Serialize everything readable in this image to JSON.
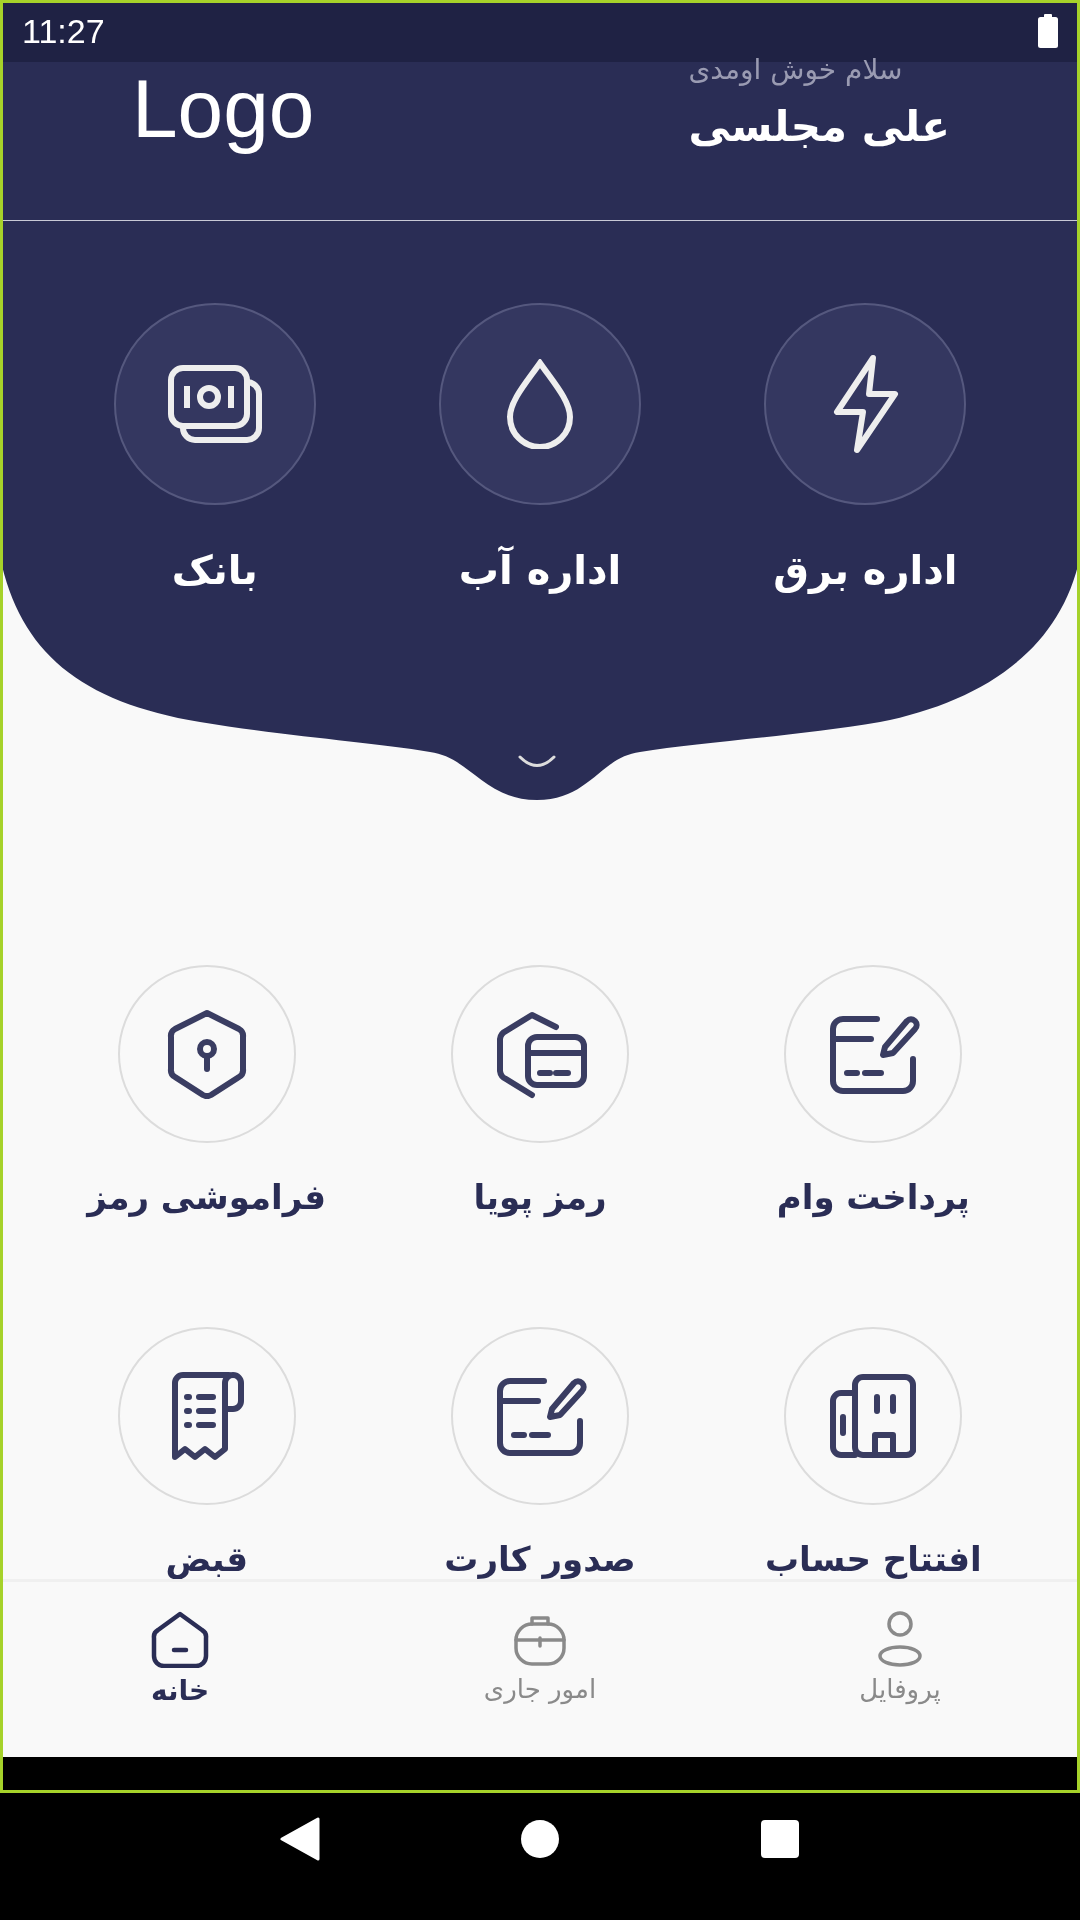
{
  "status_bar": {
    "time": "11:27"
  },
  "header": {
    "logo": "Logo",
    "greeting": "سلام خوش اومدی",
    "user_name": "علی مجلسی"
  },
  "featured_services": [
    {
      "label": "اداره برق"
    },
    {
      "label": "اداره آب"
    },
    {
      "label": "بانک"
    }
  ],
  "services": [
    {
      "label": "پرداخت وام"
    },
    {
      "label": "رمز پویا"
    },
    {
      "label": "فراموشی رمز"
    },
    {
      "label": "افتتاح حساب"
    },
    {
      "label": "صدور کارت"
    },
    {
      "label": "قبض"
    }
  ],
  "bottom_nav": [
    {
      "label": "پروفایل",
      "selected": false
    },
    {
      "label": "امور جاری",
      "selected": false
    },
    {
      "label": "خانه",
      "selected": true
    }
  ]
}
